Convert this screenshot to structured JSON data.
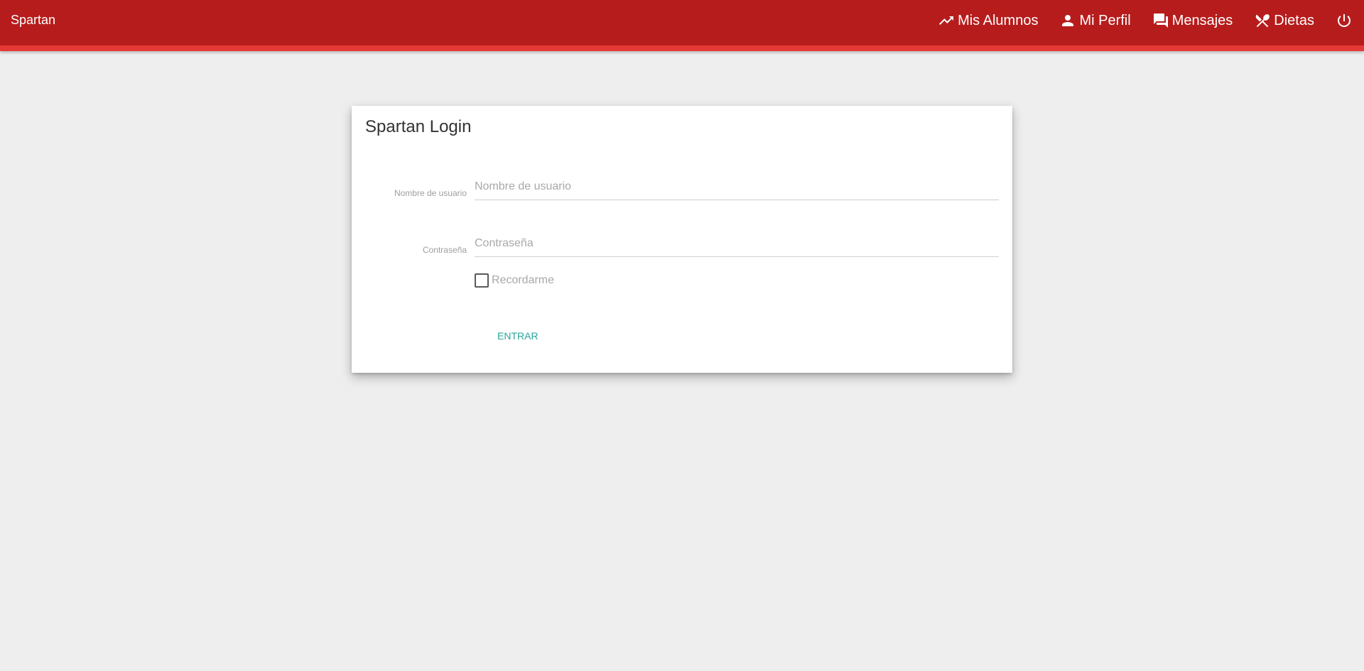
{
  "header": {
    "brand": "Spartan",
    "nav": [
      {
        "label": "Mis Alumnos",
        "icon": "trending-up-icon"
      },
      {
        "label": "Mi Perfil",
        "icon": "person-icon"
      },
      {
        "label": "Mensajes",
        "icon": "forum-icon"
      },
      {
        "label": "Dietas",
        "icon": "restaurant-icon"
      }
    ],
    "logout_icon": "power-icon"
  },
  "login": {
    "title": "Spartan Login",
    "username_label": "Nombre de usuario",
    "username_placeholder": "Nombre de usuario",
    "password_label": "Contraseña",
    "password_placeholder": "Contraseña",
    "remember_label": "Recordarme",
    "remember_checked": false,
    "submit_label": "ENTRAR"
  },
  "colors": {
    "header": "#b71c1c",
    "header_accent": "#e53935",
    "background": "#eeeeee",
    "button_text": "#26a69a"
  }
}
